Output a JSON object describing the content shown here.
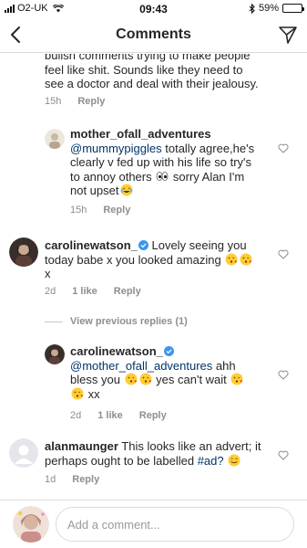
{
  "status_bar": {
    "carrier": "O2-UK",
    "time": "09:43",
    "battery": "59%",
    "battery_level": 0.59,
    "icons": [
      "signal-icon",
      "wifi-icon",
      "bluetooth-icon",
      "battery-icon"
    ]
  },
  "header": {
    "title": "Comments",
    "back_icon": "chevron-left-icon",
    "share_icon": "send-icon"
  },
  "comments": [
    {
      "text_lines": [
        "bullsh comments trying to make people",
        "feel like shit. Sounds like they need to",
        "see a doctor and deal with their jealousy."
      ],
      "time": "15h",
      "reply_label": "Reply"
    },
    {
      "username": "mother_ofall_adventures",
      "mention": "@mummypiggles",
      "text_a": " totally agree,he's",
      "text_b": "clearly v fed up with his life so try's",
      "text_c": "to annoy others",
      "text_d": " sorry Alan I'm",
      "text_e": "not upset",
      "time": "15h",
      "reply_label": "Reply"
    },
    {
      "username": "carolinewatson_",
      "text_a": " Lovely seeing you",
      "text_b": "today babe x you looked amazing ",
      "text_c": "x",
      "time": "2d",
      "likes": "1 like",
      "reply_label": "Reply"
    },
    {
      "view_previous": "View previous replies (1)"
    },
    {
      "username": "carolinewatson_",
      "mention": "@mother_ofall_adventures",
      "text_a": " ahh",
      "text_b": "bless you ",
      "text_c": " yes can't wait ",
      "text_d": " xx",
      "time": "2d",
      "likes": "1 like",
      "reply_label": "Reply"
    },
    {
      "username": "alanmaunger",
      "text_a": " This looks like an advert; it",
      "text_b": "perhaps ought to be labelled ",
      "tag": "#ad?",
      "time": "1d",
      "reply_label": "Reply"
    }
  ],
  "composer": {
    "placeholder": "Add a comment..."
  },
  "colors": {
    "text": "#262626",
    "meta": "#8e8e8e",
    "mention": "#003569",
    "verified": "#3897f0",
    "divider": "#dbdbdb"
  }
}
